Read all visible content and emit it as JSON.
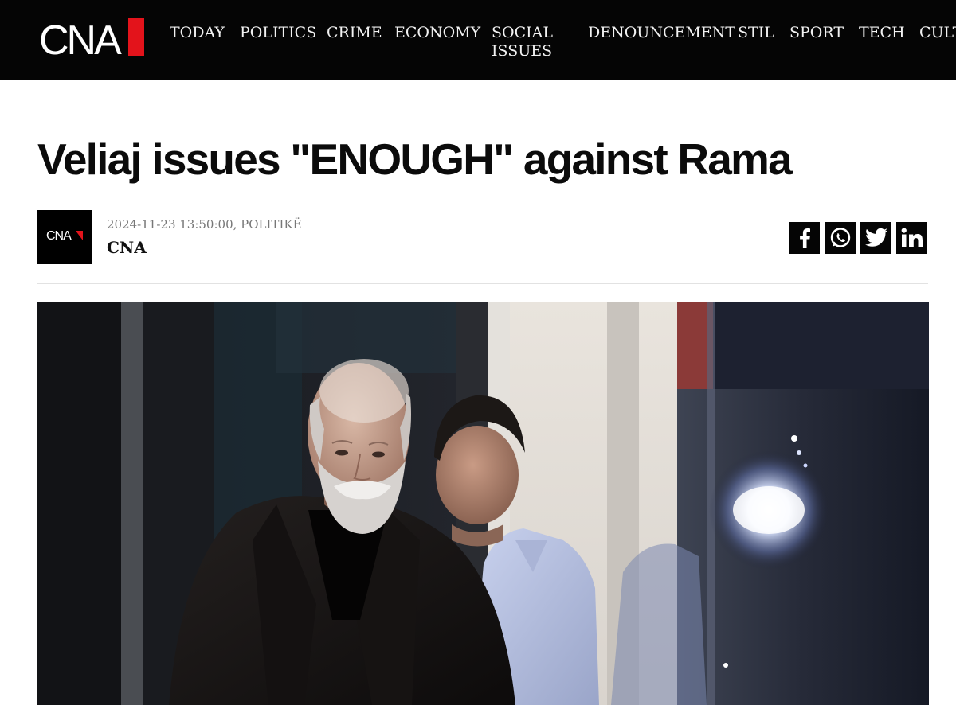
{
  "site": {
    "logo_text": "CNA",
    "brand_color": "#e3131b"
  },
  "nav": {
    "items": [
      {
        "label": "TODAY"
      },
      {
        "label": "POLITICS"
      },
      {
        "label": "CRIME"
      },
      {
        "label": "ECONOMY"
      },
      {
        "label": "SOCIAL ISSUES"
      },
      {
        "label": "DENOUNCEMENT"
      },
      {
        "label": "STIL"
      },
      {
        "label": "SPORT"
      },
      {
        "label": "TECH"
      },
      {
        "label": "CULT"
      }
    ]
  },
  "article": {
    "title": "Veliaj issues \"ENOUGH\" against Rama",
    "date_category": "2024-11-23 13:50:00, POLITIKË",
    "author": "CNA",
    "author_avatar_text": "CNA"
  },
  "share": {
    "buttons": [
      {
        "icon": "facebook-icon"
      },
      {
        "icon": "whatsapp-icon"
      },
      {
        "icon": "twitter-icon"
      },
      {
        "icon": "linkedin-icon"
      }
    ]
  },
  "photo": {
    "subject": "two men walking through glass doors at night"
  }
}
